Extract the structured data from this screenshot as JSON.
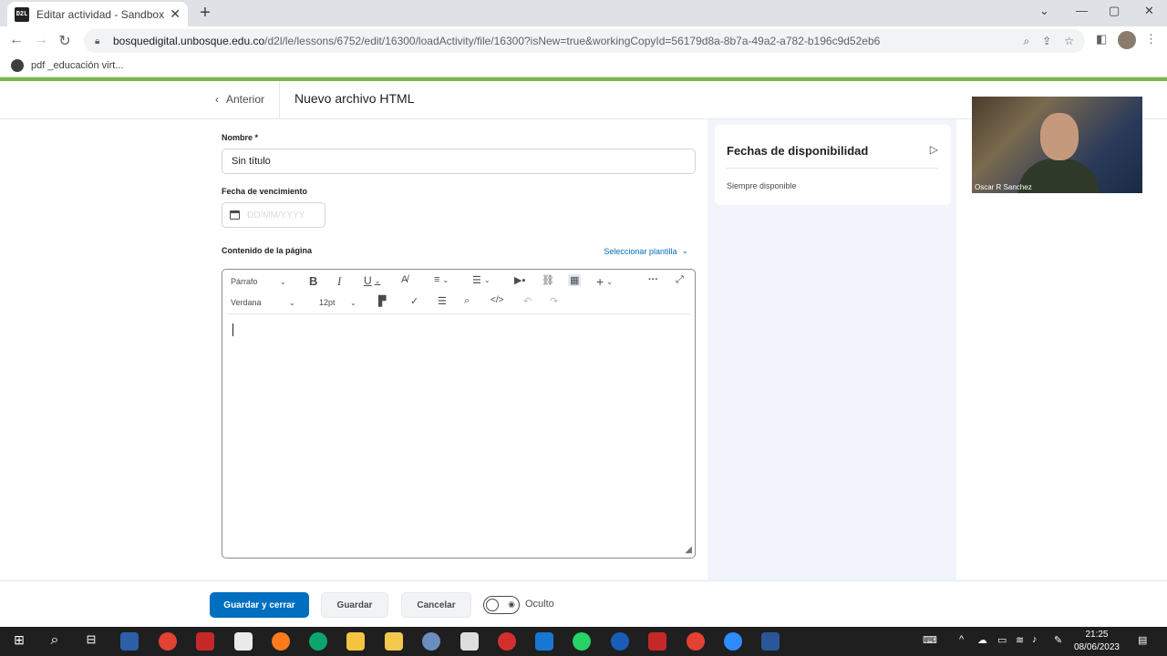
{
  "browser": {
    "tab_title": "Editar actividad - Sandbox - sanc",
    "favicon_text": "D2L",
    "url_host": "bosquedigital.unbosque.edu.co",
    "url_path": "/d2l/le/lessons/6752/edit/16300/loadActivity/file/16300?isNew=true&workingCopyId=56179d8a-8b7a-49a2-a782-b196c9d52eb6",
    "bookmark": "pdf _educación virt..."
  },
  "header": {
    "back_label": "Anterior",
    "title": "Nuevo archivo HTML"
  },
  "form": {
    "name_label": "Nombre *",
    "name_value": "Sin título",
    "due_label": "Fecha de vencimiento",
    "due_placeholder": "DD/MM/YYYY",
    "content_label": "Contenido de la página",
    "template_link": "Seleccionar plantilla"
  },
  "editor": {
    "block_format": "Párrafo",
    "font_family": "Verdana",
    "font_size": "12pt"
  },
  "sidebar": {
    "availability_title": "Fechas de disponibilidad",
    "availability_status": "Siempre disponible"
  },
  "video": {
    "participant_name": "Oscar R Sanchez"
  },
  "footer": {
    "save_close": "Guardar y cerrar",
    "save": "Guardar",
    "cancel": "Cancelar",
    "visibility": "Oculto"
  },
  "taskbar": {
    "time": "21:25",
    "date": "08/06/2023"
  },
  "colors": {
    "primary": "#006fbf",
    "accent_bar": "#7ab648",
    "sidebar_bg": "#f1f5fb"
  }
}
